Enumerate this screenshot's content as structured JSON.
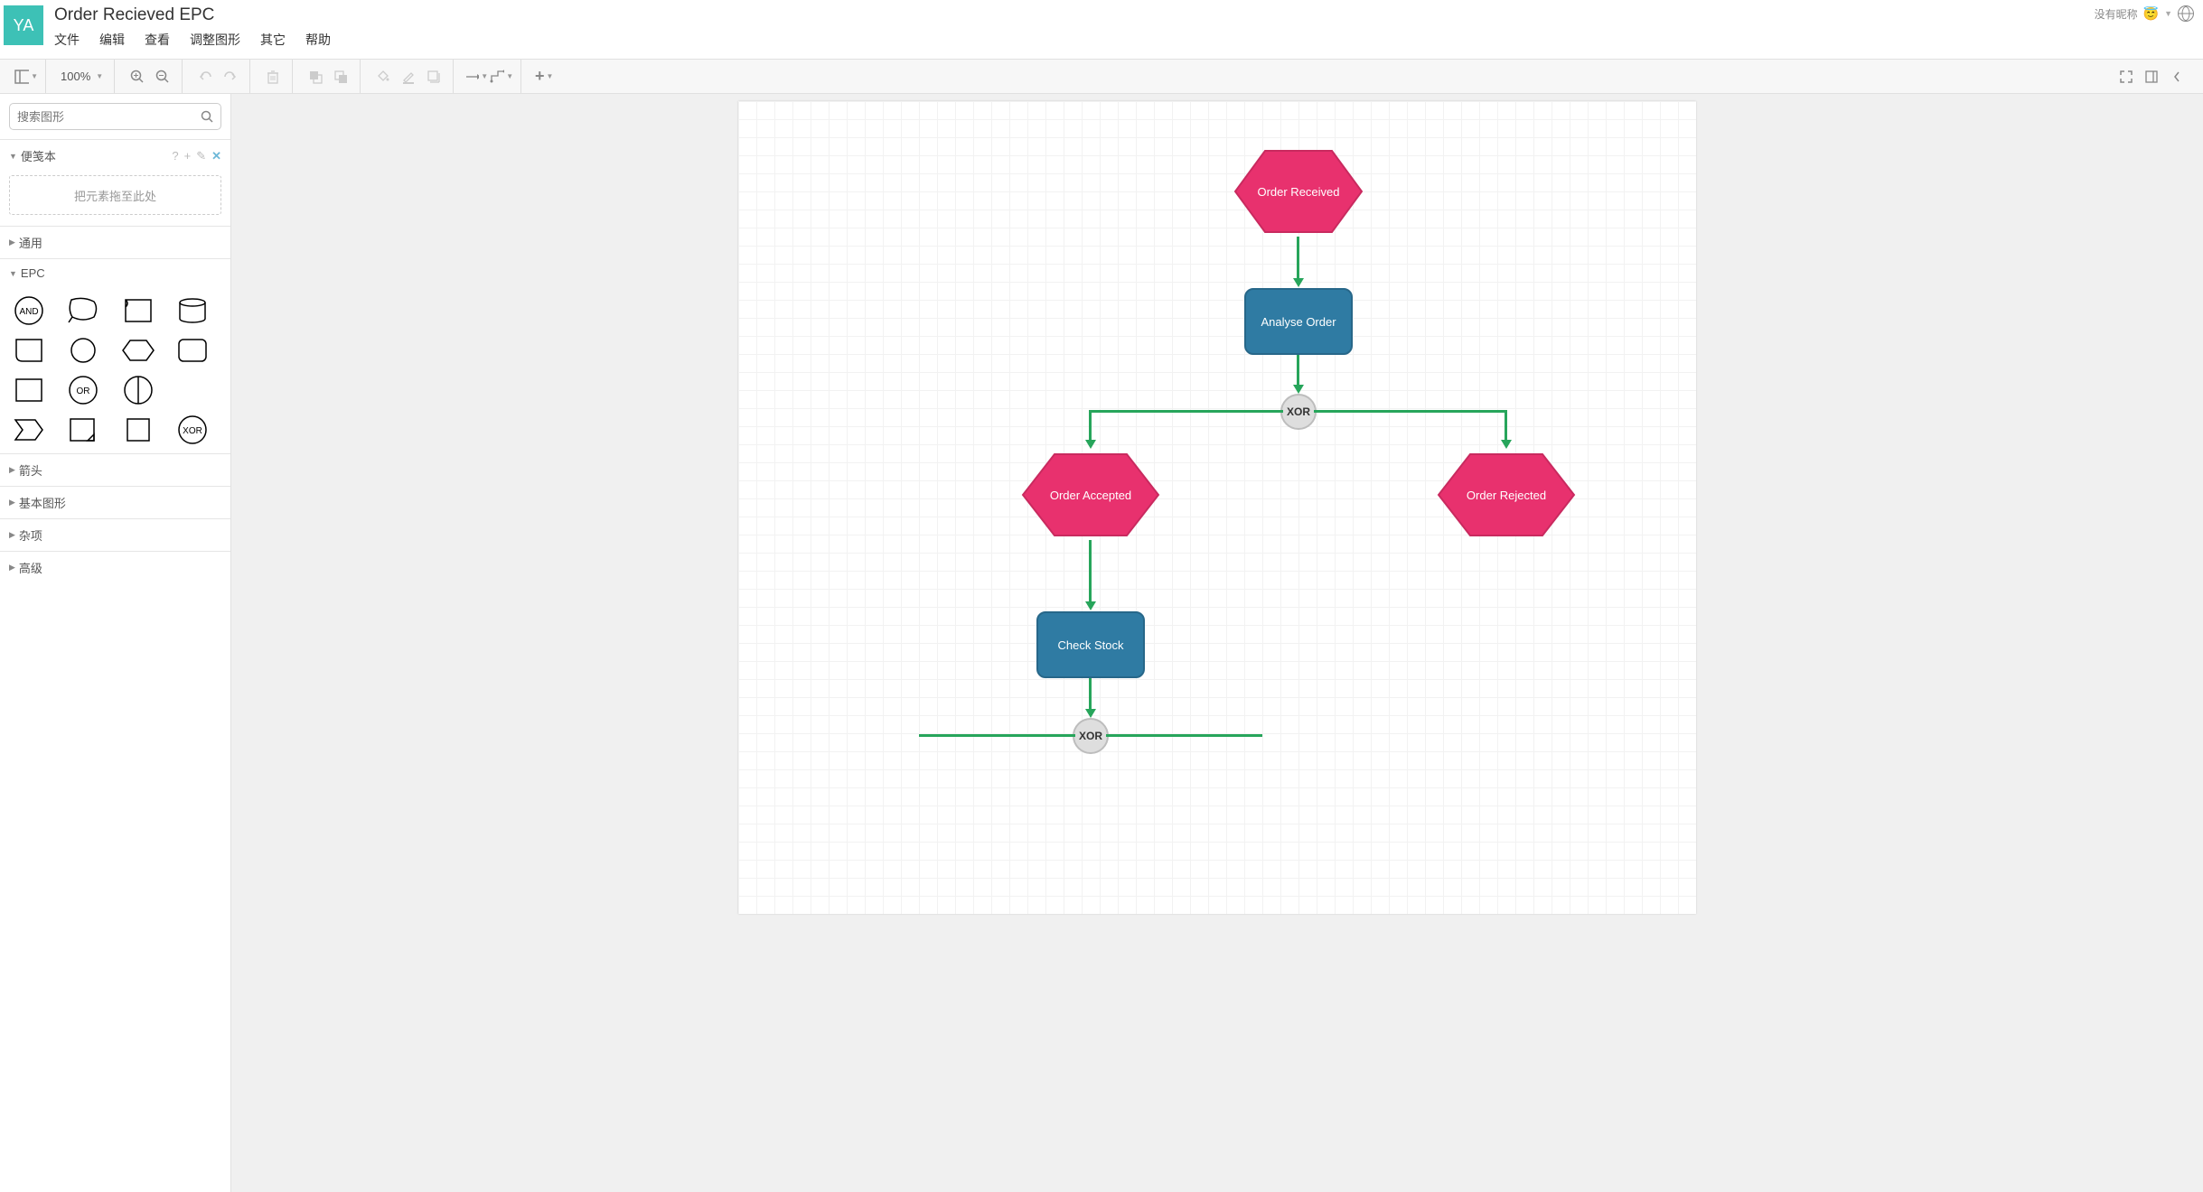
{
  "logo_text": "YA",
  "doc_title": "Order Recieved EPC",
  "menubar": {
    "file": "文件",
    "edit": "编辑",
    "view": "查看",
    "shape": "调整图形",
    "other": "其它",
    "help": "帮助"
  },
  "header_right": {
    "nickname": "没有昵称"
  },
  "toolbar": {
    "zoom": "100%"
  },
  "sidebar": {
    "search_placeholder": "搜索图形",
    "scratchpad": {
      "title": "便笺本",
      "drop_hint": "把元素拖至此处"
    },
    "sections": {
      "general": "通用",
      "epc": "EPC",
      "arrows": "箭头",
      "basic": "基本图形",
      "misc": "杂项",
      "advanced": "高级"
    },
    "epc_labels": {
      "and": "AND",
      "or": "OR",
      "xor": "XOR"
    }
  },
  "diagram": {
    "order_received": "Order Received",
    "analyse_order": "Analyse Order",
    "xor1": "XOR",
    "order_accepted": "Order Accepted",
    "order_rejected": "Order Rejected",
    "check_stock": "Check Stock",
    "xor2": "XOR"
  }
}
